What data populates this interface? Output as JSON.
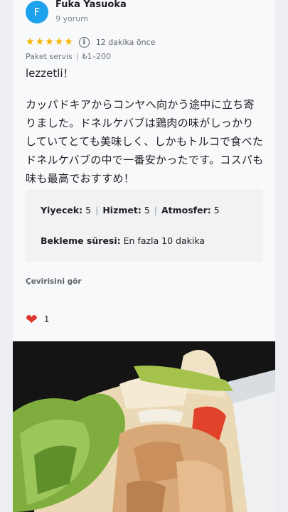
{
  "reviewer": {
    "initial": "F",
    "name": "Fuka Yasuoka",
    "review_count": "9 yorum"
  },
  "rating": {
    "stars": 5,
    "max_stars": 5,
    "time_ago": "12 dakika önce"
  },
  "meta": {
    "service": "Paket servis",
    "price": "₺1–200"
  },
  "review": {
    "title": "lezzetli！",
    "lines": [
      "カッパドキアからコンヤへ向かう途中に立ち寄",
      "りました。ドネルケバブは鶏肉の味がしっかり",
      "していてとても美味しく、しかもトルコで食べた",
      "ドネルケバブの中で一番安かったです。コスパも",
      "味も最高でおすすめ！"
    ]
  },
  "attributes": {
    "food_label": "Yiyecek:",
    "food_value": "5",
    "service_label": "Hizmet:",
    "service_value": "5",
    "atmosphere_label": "Atmosfer:",
    "atmosphere_value": "5",
    "wait_label": "Bekleme süresi:",
    "wait_value": "En fazla 10 dakika"
  },
  "actions": {
    "translate": "Çevirisini gör",
    "like_count": "1"
  },
  "icons": {
    "star": "star-icon",
    "info": "info-icon",
    "heart": "heart-icon"
  },
  "colors": {
    "avatar": "#1da1ec",
    "star": "#f4b400",
    "heart": "#e0332d"
  }
}
